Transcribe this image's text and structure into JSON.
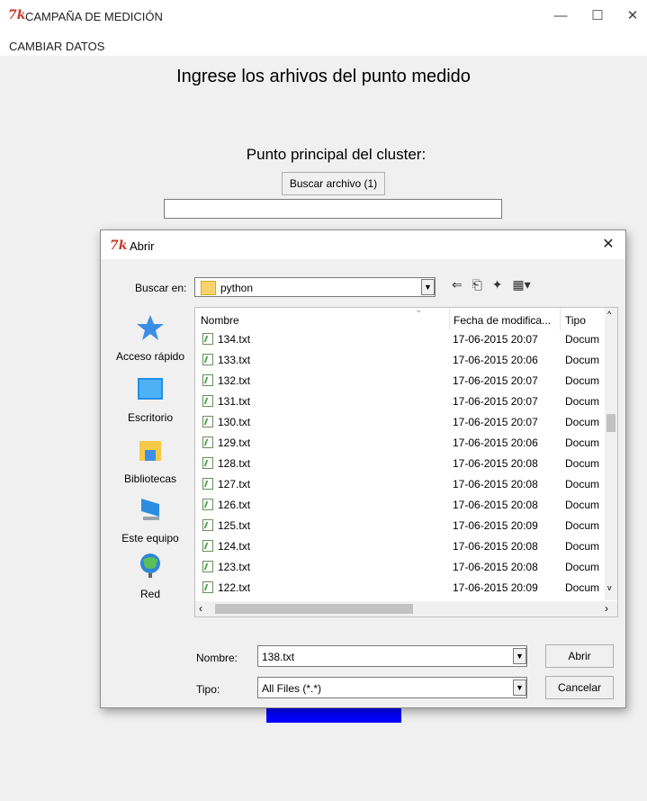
{
  "window": {
    "title": "CAMPAÑA DE MEDICIÓN",
    "logo": "7k",
    "minimize": "—",
    "maximize": "☐",
    "close": "✕"
  },
  "menu": {
    "item": "CAMBIAR DATOS"
  },
  "main": {
    "heading": "Ingrese los arhivos del punto medido",
    "cluster_label": "Punto principal del cluster:",
    "buscar_button": "Buscar archivo (1)",
    "file_entry_value": ""
  },
  "dialog": {
    "title": "Abrir",
    "close": "✕",
    "buscar_en_label": "Buscar en:",
    "location": "python",
    "places": [
      {
        "label": "Acceso rápido",
        "icon": "star-icon"
      },
      {
        "label": "Escritorio",
        "icon": "desktop-icon"
      },
      {
        "label": "Bibliotecas",
        "icon": "libraries-icon"
      },
      {
        "label": "Este equipo",
        "icon": "computer-icon"
      },
      {
        "label": "Red",
        "icon": "network-icon"
      }
    ],
    "columns": {
      "name": "Nombre",
      "date": "Fecha de modifica...",
      "type": "Tipo"
    },
    "files": [
      {
        "name": "134.txt",
        "date": "17-06-2015 20:07",
        "type": "Docum"
      },
      {
        "name": "133.txt",
        "date": "17-06-2015 20:06",
        "type": "Docum"
      },
      {
        "name": "132.txt",
        "date": "17-06-2015 20:07",
        "type": "Docum"
      },
      {
        "name": "131.txt",
        "date": "17-06-2015 20:07",
        "type": "Docum"
      },
      {
        "name": "130.txt",
        "date": "17-06-2015 20:07",
        "type": "Docum"
      },
      {
        "name": "129.txt",
        "date": "17-06-2015 20:06",
        "type": "Docum"
      },
      {
        "name": "128.txt",
        "date": "17-06-2015 20:08",
        "type": "Docum"
      },
      {
        "name": "127.txt",
        "date": "17-06-2015 20:08",
        "type": "Docum"
      },
      {
        "name": "126.txt",
        "date": "17-06-2015 20:08",
        "type": "Docum"
      },
      {
        "name": "125.txt",
        "date": "17-06-2015 20:09",
        "type": "Docum"
      },
      {
        "name": "124.txt",
        "date": "17-06-2015 20:08",
        "type": "Docum"
      },
      {
        "name": "123.txt",
        "date": "17-06-2015 20:08",
        "type": "Docum"
      },
      {
        "name": "122.txt",
        "date": "17-06-2015 20:09",
        "type": "Docum"
      }
    ],
    "nombre_label": "Nombre:",
    "nombre_value": "138.txt",
    "tipo_label": "Tipo:",
    "tipo_value": "All Files (*.*)",
    "abrir_button": "Abrir",
    "cancelar_button": "Cancelar"
  }
}
